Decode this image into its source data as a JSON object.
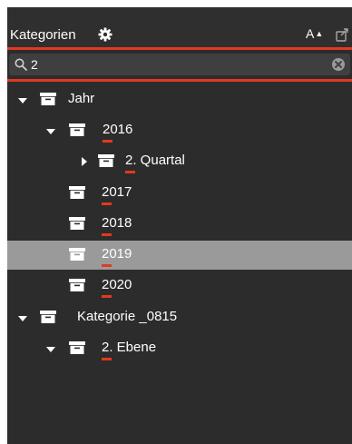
{
  "header": {
    "title": "Kategorien",
    "sort_label": "A",
    "sort_arrow": "▲",
    "icons": [
      "gear-icon",
      "export-icon"
    ]
  },
  "search": {
    "value": "2",
    "placeholder": "",
    "icons": [
      "search-icon",
      "clear-icon"
    ]
  },
  "tree": {
    "items": [
      {
        "label": "Jahr",
        "level": 0,
        "expanded": true,
        "highlight": ""
      },
      {
        "label": "2016",
        "level": 1,
        "expanded": true,
        "highlight": "2"
      },
      {
        "label": "2. Quartal",
        "level": 2,
        "expanded": false,
        "highlight": "2"
      },
      {
        "label": "2017",
        "level": 1,
        "highlight": "2"
      },
      {
        "label": "2018",
        "level": 1,
        "highlight": "2"
      },
      {
        "label": "2019",
        "level": 1,
        "highlight": "2",
        "selected": true
      },
      {
        "label": "2020",
        "level": 1,
        "highlight": "2"
      },
      {
        "label": "Kategorie _0815",
        "level": 0,
        "expanded": true,
        "highlight": ""
      },
      {
        "label": "2. Ebene",
        "level": 1,
        "expanded": true,
        "highlight": "2"
      }
    ]
  },
  "colors": {
    "panel_bg": "#2c2c2c",
    "selection_bg": "#9a9a9a",
    "accent": "#e03a22",
    "text": "#ffffff"
  }
}
